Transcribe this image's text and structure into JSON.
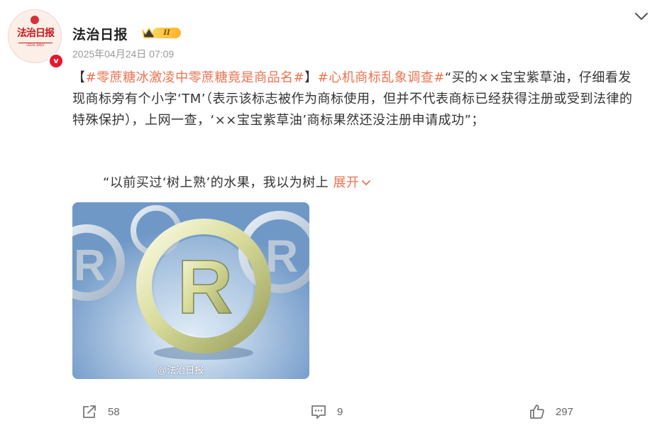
{
  "post": {
    "author": {
      "name": "法治日报",
      "avatar_text": "法治日报",
      "avatar_subtext": "LEGAL DAILY",
      "verified_mark": "v",
      "vip_level": "II"
    },
    "timestamp": "2025年04月24日 07:09",
    "content": {
      "bracket_open": "【",
      "topic1": "#零蔗糖冰激凌中零蔗糖竟是商品名#",
      "bracket_close": "】",
      "topic2": "#心机商标乱象调查#",
      "body": "“买的××宝宝紫草油，仔细看发现商标旁有个小字‘TM’（表示该标志被作为商标使用，但并不代表商标已经获得注册或受到法律的特殊保护），上网一查，‘××宝宝紫草油’商标果然还没注册申请成功”；",
      "para2": "“以前买过‘树上熟’的水果，我以为树上",
      "expand_label": "展开"
    },
    "image": {
      "watermark": "@法治日报",
      "description_icon": "registered-trademark-symbols"
    },
    "actions": {
      "share_count": "58",
      "comment_count": "9",
      "like_count": "297"
    }
  },
  "colors": {
    "topic": "#eb7350",
    "verified": "#e6162d",
    "text": "#333333",
    "muted": "#999999"
  }
}
